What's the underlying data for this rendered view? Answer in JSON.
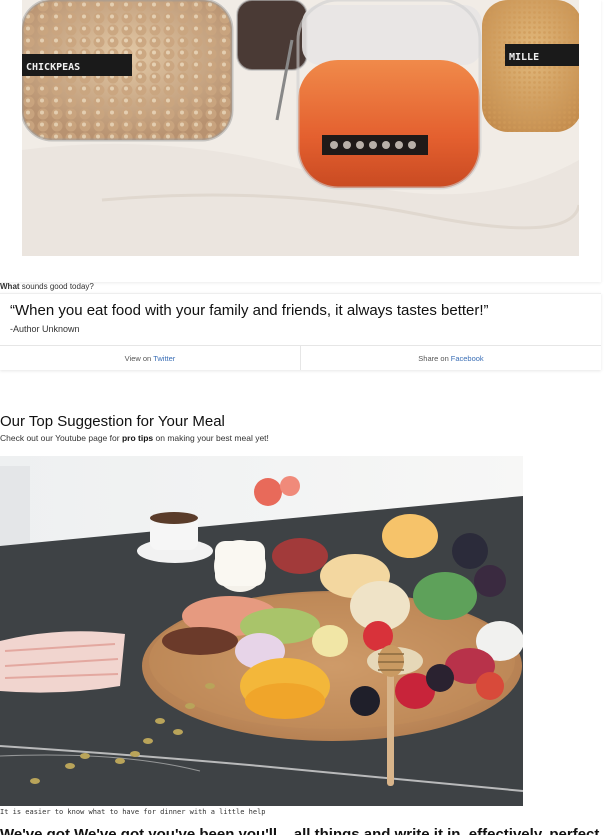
{
  "top_image": {
    "jar_labels": [
      "CHICKPEAS",
      "MILLET"
    ],
    "caption_bold": "What",
    "caption_rest": "sounds good today?"
  },
  "quote": {
    "text": "“When you eat food with your family and friends, it always tastes better!”",
    "author": "-Author Unknown",
    "view_prefix": "View on",
    "view_link": "Twitter",
    "share_prefix": "Share on",
    "share_link": "Facebook"
  },
  "suggestion": {
    "title": "Our Top Suggestion for Your Meal",
    "sub_before": "Check out our Youtube page for",
    "sub_bold": "pro tips",
    "sub_after": "on making your best meal yet!",
    "photo_caption": "It is easier to know what to have for dinner with a little help"
  },
  "next_heading": "We've got We've got you've been you'll... all things and write it in, effectively, perfect shall be and",
  "colors": {
    "link": "#3b6fb6",
    "text": "#111111",
    "muted": "#555555"
  }
}
